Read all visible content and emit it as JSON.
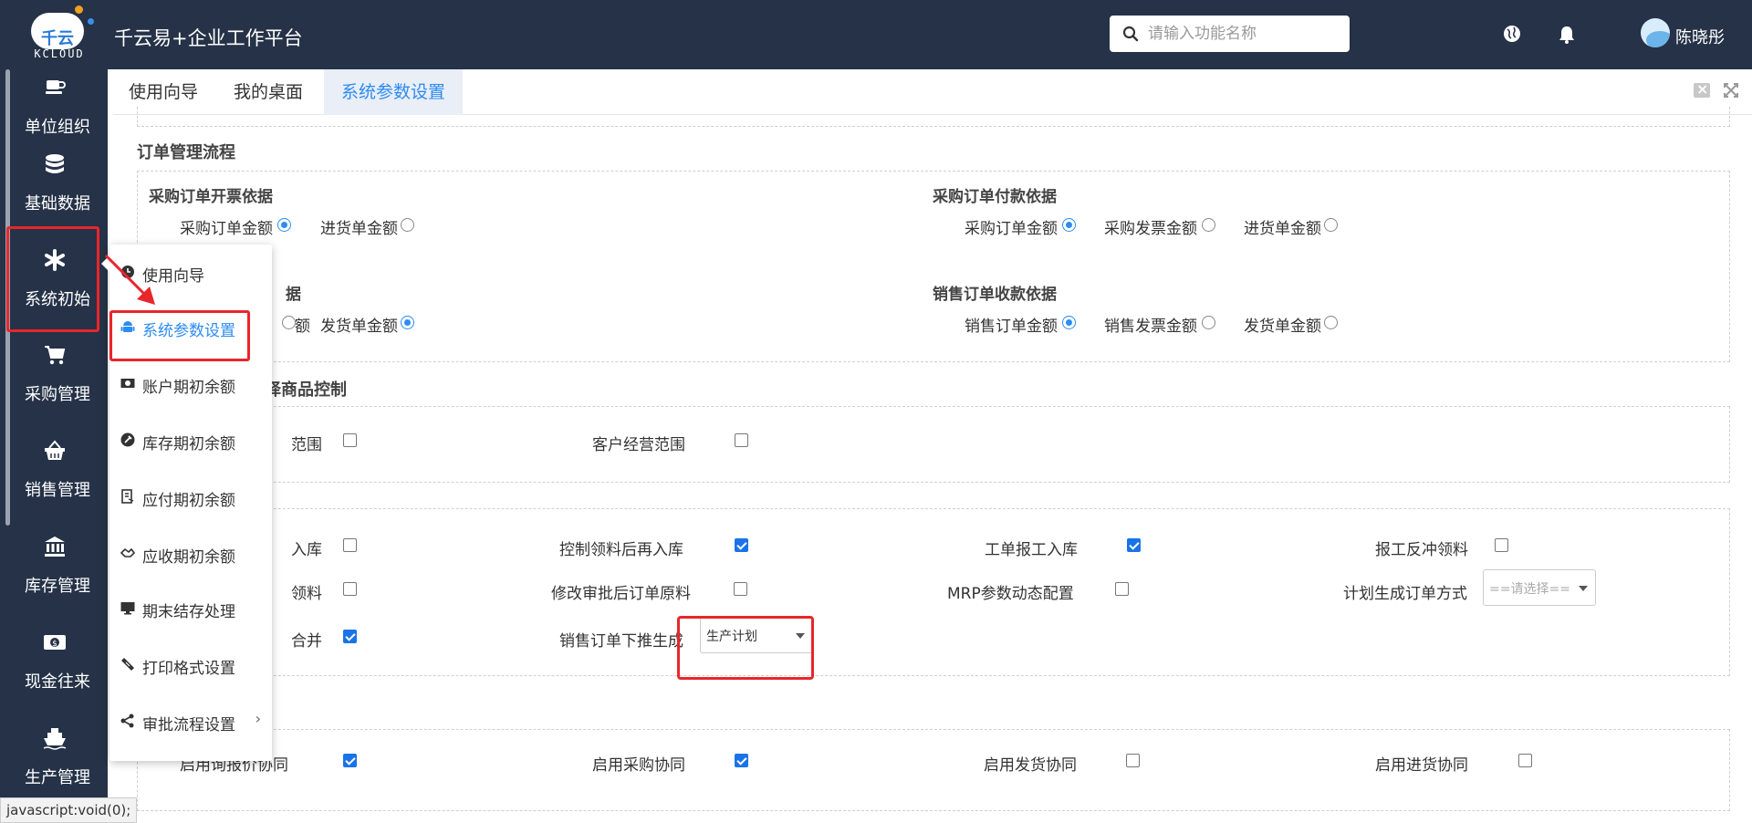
{
  "topbar": {
    "brand": "KCLOUD",
    "logo_glyph": "千云",
    "title": "千云易+企业工作平台",
    "search_placeholder": "请输入功能名称",
    "username": "陈晓彤",
    "colors": {
      "bg": "#253247",
      "accent": "#2d8cf0",
      "highlight": "#e8262b"
    }
  },
  "sidebar": {
    "items": [
      {
        "label": "单位组织",
        "icon": "cup-icon"
      },
      {
        "label": "基础数据",
        "icon": "database-icon"
      },
      {
        "label": "系统初始",
        "icon": "asterisk-icon"
      },
      {
        "label": "采购管理",
        "icon": "cart-icon"
      },
      {
        "label": "销售管理",
        "icon": "basket-icon"
      },
      {
        "label": "库存管理",
        "icon": "bank-icon"
      },
      {
        "label": "现金往来",
        "icon": "money-icon"
      },
      {
        "label": "生产管理",
        "icon": "ship-icon"
      }
    ]
  },
  "submenu": {
    "items": [
      {
        "label": "使用向导",
        "icon": "clock-icon"
      },
      {
        "label": "系统参数设置",
        "icon": "android-icon"
      },
      {
        "label": "账户期初余额",
        "icon": "money-icon"
      },
      {
        "label": "库存期初余额",
        "icon": "wrench-icon"
      },
      {
        "label": "应付期初余额",
        "icon": "payable-icon"
      },
      {
        "label": "应收期初余额",
        "icon": "handshake-icon"
      },
      {
        "label": "期末结存处理",
        "icon": "monitor-icon"
      },
      {
        "label": "打印格式设置",
        "icon": "ticket-icon"
      },
      {
        "label": "审批流程设置",
        "icon": "share-icon"
      }
    ],
    "active": "系统参数设置"
  },
  "tabs": [
    {
      "label": "使用向导"
    },
    {
      "label": "我的桌面"
    },
    {
      "label": "系统参数设置"
    }
  ],
  "content": {
    "order_flow": {
      "title": "订单管理流程",
      "purchase_invoice": {
        "title": "采购订单开票依据",
        "options": [
          {
            "label": "采购订单金额",
            "checked": true
          },
          {
            "label": "进货单金额",
            "checked": false
          }
        ]
      },
      "purchase_payment": {
        "title": "采购订单付款依据",
        "options": [
          {
            "label": "采购订单金额",
            "checked": true
          },
          {
            "label": "采购发票金额",
            "checked": false
          },
          {
            "label": "进货单金额",
            "checked": false
          }
        ]
      },
      "sales_invoice": {
        "title_fragment": "据",
        "options": [
          {
            "label": "额",
            "checked": false
          },
          {
            "label": "发货单金额",
            "checked": true
          }
        ]
      },
      "sales_receipt": {
        "title": "销售订单收款依据",
        "options": [
          {
            "label": "销售订单金额",
            "checked": true
          },
          {
            "label": "销售发票金额",
            "checked": false
          },
          {
            "label": "发货单金额",
            "checked": false
          }
        ]
      }
    },
    "goods_control": {
      "title_fragment": "择商品控制",
      "items": [
        {
          "label": "范围",
          "checked": false
        },
        {
          "label": "客户经营范围",
          "checked": false
        }
      ]
    },
    "production": {
      "row1": [
        {
          "label": "入库",
          "checked": false
        },
        {
          "label": "控制领料后再入库",
          "checked": true
        },
        {
          "label": "工单报工入库",
          "checked": true
        },
        {
          "label": "报工反冲领料",
          "checked": false
        }
      ],
      "row2": [
        {
          "label": "领料",
          "checked": false
        },
        {
          "label": "修改审批后订单原料",
          "checked": false
        },
        {
          "label": "MRP参数动态配置",
          "checked": false
        },
        {
          "label": "计划生成订单方式",
          "select": "==请选择=="
        }
      ],
      "row3": [
        {
          "label": "合并",
          "checked": true
        },
        {
          "label": "销售订单下推生成",
          "select": "生产计划"
        }
      ]
    },
    "collaboration": {
      "items": [
        {
          "label": "启用询报价协同",
          "checked": true
        },
        {
          "label": "启用采购协同",
          "checked": true
        },
        {
          "label": "启用发货协同",
          "checked": false
        },
        {
          "label": "启用进货协同",
          "checked": false
        }
      ]
    }
  },
  "statusbar": {
    "text": "javascript:void(0);"
  }
}
